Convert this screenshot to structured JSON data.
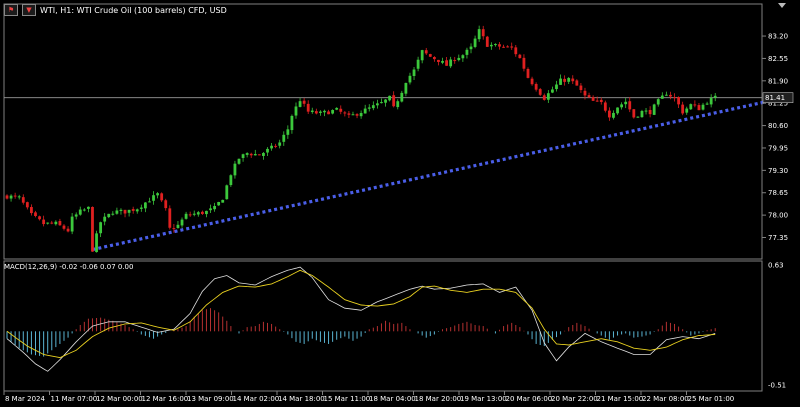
{
  "header": {
    "symbol_icon": "flag-icon",
    "indicator_icon": "candles-icon",
    "title": "WTI, H1:  WTI Crude Oil (100 barrels) CFD, USD"
  },
  "macd_label": "MACD(12,26,9) -0.02 -0.06 0.07 0.00",
  "colors": {
    "background": "#000000",
    "bull": "#3cc83c",
    "bear": "#e02020",
    "trendline": "#4a5ee8",
    "hist_pos": "#b43030",
    "hist_neg": "#5ab4d2",
    "signal": "#e8d020",
    "macd_line": "#e0e0e0",
    "grid": "#808080"
  },
  "chart_data": [
    {
      "type": "candlestick",
      "symbol": "WTI",
      "timeframe": "H1",
      "y_ticks": [
        "83.20",
        "82.55",
        "81.90",
        "81.25",
        "80.60",
        "79.95",
        "79.30",
        "78.65",
        "78.00",
        "77.35"
      ],
      "ylim": [
        76.9,
        83.55
      ],
      "current_price": "81.41",
      "x_ticks": [
        "8 Mar 2024",
        "11 Mar 07:00",
        "12 Mar 00:00",
        "12 Mar 16:00",
        "13 Mar 09:00",
        "14 Mar 02:00",
        "14 Mar 18:00",
        "15 Mar 11:00",
        "18 Mar 04:00",
        "18 Mar 20:00",
        "19 Mar 13:00",
        "20 Mar 06:00",
        "20 Mar 22:00",
        "21 Mar 15:00",
        "22 Mar 08:00",
        "25 Mar 01:00"
      ],
      "close_path": [
        [
          0,
          78.55
        ],
        [
          3,
          78.5
        ],
        [
          6,
          78.0
        ],
        [
          9,
          77.75
        ],
        [
          12,
          77.75
        ],
        [
          15,
          77.55
        ],
        [
          16,
          77.9
        ],
        [
          18,
          78.1
        ],
        [
          20,
          78.2
        ],
        [
          21,
          77.0
        ],
        [
          23,
          77.8
        ],
        [
          26,
          78.1
        ],
        [
          29,
          78.1
        ],
        [
          32,
          78.2
        ],
        [
          35,
          78.45
        ],
        [
          37,
          78.6
        ],
        [
          39,
          78.15
        ],
        [
          40,
          77.6
        ],
        [
          42,
          77.7
        ],
        [
          44,
          78.0
        ],
        [
          47,
          78.05
        ],
        [
          49,
          78.1
        ],
        [
          51,
          78.2
        ],
        [
          53,
          78.5
        ],
        [
          55,
          79.2
        ],
        [
          57,
          79.65
        ],
        [
          59,
          79.8
        ],
        [
          62,
          79.75
        ],
        [
          65,
          79.95
        ],
        [
          67,
          80.1
        ],
        [
          69,
          80.5
        ],
        [
          70,
          80.9
        ],
        [
          72,
          81.35
        ],
        [
          74,
          81.0
        ],
        [
          77,
          80.95
        ],
        [
          79,
          81.0
        ],
        [
          81,
          81.05
        ],
        [
          84,
          80.85
        ],
        [
          86,
          80.95
        ],
        [
          88,
          81.05
        ],
        [
          90,
          81.15
        ],
        [
          92,
          81.25
        ],
        [
          94,
          81.4
        ],
        [
          95,
          81.1
        ],
        [
          97,
          81.6
        ],
        [
          98,
          81.9
        ],
        [
          100,
          82.2
        ],
        [
          102,
          82.75
        ],
        [
          104,
          82.6
        ],
        [
          106,
          82.5
        ],
        [
          108,
          82.35
        ],
        [
          110,
          82.55
        ],
        [
          112,
          82.65
        ],
        [
          114,
          82.85
        ],
        [
          116,
          83.35
        ],
        [
          118,
          82.95
        ],
        [
          121,
          82.9
        ],
        [
          124,
          82.85
        ],
        [
          126,
          82.55
        ],
        [
          128,
          82.0
        ],
        [
          130,
          81.7
        ],
        [
          132,
          81.4
        ],
        [
          134,
          81.65
        ],
        [
          136,
          81.9
        ],
        [
          138,
          81.95
        ],
        [
          140,
          81.75
        ],
        [
          142,
          81.45
        ],
        [
          144,
          81.3
        ],
        [
          146,
          81.25
        ],
        [
          148,
          80.9
        ],
        [
          150,
          81.15
        ],
        [
          152,
          81.3
        ],
        [
          154,
          80.85
        ],
        [
          156,
          81.0
        ],
        [
          158,
          81.0
        ],
        [
          160,
          81.3
        ],
        [
          162,
          81.55
        ],
        [
          164,
          81.4
        ],
        [
          166,
          81.0
        ],
        [
          168,
          81.2
        ],
        [
          170,
          81.1
        ],
        [
          172,
          81.3
        ],
        [
          174,
          81.41
        ]
      ],
      "trendline": {
        "style": "dotted",
        "from": [
          21,
          77.0
        ],
        "to": [
          186,
          81.28
        ]
      }
    },
    {
      "type": "bar",
      "indicator": "MACD",
      "params": [
        12,
        26,
        9
      ],
      "readout": [
        -0.02,
        -0.06,
        0.07,
        0.0
      ],
      "y_ticks": [
        "0.63",
        "-0.51"
      ],
      "ylim": [
        -0.51,
        0.63
      ],
      "histogram_path": [
        [
          0,
          -0.07
        ],
        [
          3,
          -0.16
        ],
        [
          6,
          -0.22
        ],
        [
          9,
          -0.24
        ],
        [
          12,
          -0.15
        ],
        [
          15,
          -0.06
        ],
        [
          18,
          0.06
        ],
        [
          20,
          0.12
        ],
        [
          23,
          0.13
        ],
        [
          26,
          0.1
        ],
        [
          29,
          0.06
        ],
        [
          31,
          0.02
        ],
        [
          33,
          -0.03
        ],
        [
          36,
          -0.07
        ],
        [
          38,
          -0.03
        ],
        [
          40,
          0.0
        ],
        [
          42,
          0.02
        ],
        [
          44,
          0.05
        ],
        [
          46,
          0.14
        ],
        [
          48,
          0.2
        ],
        [
          50,
          0.22
        ],
        [
          52,
          0.18
        ],
        [
          54,
          0.1
        ],
        [
          56,
          0.0
        ],
        [
          57,
          -0.02
        ],
        [
          59,
          0.04
        ],
        [
          61,
          0.05
        ],
        [
          63,
          0.09
        ],
        [
          65,
          0.07
        ],
        [
          67,
          0.02
        ],
        [
          69,
          -0.03
        ],
        [
          71,
          -0.1
        ],
        [
          73,
          -0.12
        ],
        [
          75,
          -0.07
        ],
        [
          77,
          -0.1
        ],
        [
          79,
          -0.12
        ],
        [
          81,
          -0.08
        ],
        [
          83,
          -0.05
        ],
        [
          85,
          -0.09
        ],
        [
          87,
          -0.05
        ],
        [
          89,
          0.02
        ],
        [
          91,
          0.05
        ],
        [
          93,
          0.1
        ],
        [
          95,
          0.07
        ],
        [
          97,
          0.08
        ],
        [
          99,
          0.02
        ],
        [
          101,
          -0.02
        ],
        [
          103,
          -0.06
        ],
        [
          105,
          -0.03
        ],
        [
          107,
          0.02
        ],
        [
          109,
          0.04
        ],
        [
          111,
          0.07
        ],
        [
          113,
          0.09
        ],
        [
          115,
          0.06
        ],
        [
          117,
          0.05
        ],
        [
          119,
          0.0
        ],
        [
          120,
          -0.02
        ],
        [
          122,
          0.05
        ],
        [
          124,
          0.08
        ],
        [
          126,
          0.04
        ],
        [
          128,
          -0.03
        ],
        [
          130,
          -0.12
        ],
        [
          132,
          -0.14
        ],
        [
          134,
          -0.08
        ],
        [
          136,
          -0.03
        ],
        [
          138,
          0.04
        ],
        [
          140,
          0.08
        ],
        [
          142,
          0.05
        ],
        [
          144,
          0.0
        ],
        [
          146,
          -0.04
        ],
        [
          148,
          -0.08
        ],
        [
          150,
          -0.04
        ],
        [
          152,
          -0.02
        ],
        [
          154,
          -0.06
        ],
        [
          156,
          -0.05
        ],
        [
          158,
          -0.03
        ],
        [
          160,
          0.02
        ],
        [
          162,
          0.09
        ],
        [
          164,
          0.07
        ],
        [
          166,
          0.02
        ],
        [
          168,
          -0.04
        ],
        [
          170,
          -0.02
        ],
        [
          172,
          0.01
        ],
        [
          174,
          0.03
        ]
      ],
      "signal_path": [
        [
          0,
          0.0
        ],
        [
          5,
          -0.14
        ],
        [
          9,
          -0.22
        ],
        [
          13,
          -0.25
        ],
        [
          17,
          -0.18
        ],
        [
          21,
          -0.05
        ],
        [
          25,
          0.03
        ],
        [
          29,
          0.07
        ],
        [
          33,
          0.08
        ],
        [
          37,
          0.04
        ],
        [
          41,
          0.01
        ],
        [
          45,
          0.09
        ],
        [
          49,
          0.25
        ],
        [
          53,
          0.37
        ],
        [
          57,
          0.43
        ],
        [
          61,
          0.42
        ],
        [
          65,
          0.45
        ],
        [
          69,
          0.52
        ],
        [
          72,
          0.58
        ],
        [
          75,
          0.53
        ],
        [
          79,
          0.42
        ],
        [
          83,
          0.3
        ],
        [
          87,
          0.25
        ],
        [
          91,
          0.24
        ],
        [
          95,
          0.26
        ],
        [
          99,
          0.33
        ],
        [
          102,
          0.42
        ],
        [
          105,
          0.43
        ],
        [
          109,
          0.39
        ],
        [
          113,
          0.37
        ],
        [
          117,
          0.4
        ],
        [
          121,
          0.4
        ],
        [
          125,
          0.37
        ],
        [
          129,
          0.22
        ],
        [
          132,
          0.02
        ],
        [
          135,
          -0.12
        ],
        [
          138,
          -0.13
        ],
        [
          142,
          -0.1
        ],
        [
          146,
          -0.07
        ],
        [
          150,
          -0.1
        ],
        [
          154,
          -0.16
        ],
        [
          158,
          -0.18
        ],
        [
          162,
          -0.15
        ],
        [
          166,
          -0.08
        ],
        [
          170,
          -0.04
        ],
        [
          174,
          -0.03
        ]
      ],
      "macd_path": [
        [
          0,
          -0.07
        ],
        [
          4,
          -0.2
        ],
        [
          7,
          -0.31
        ],
        [
          10,
          -0.38
        ],
        [
          13,
          -0.27
        ],
        [
          17,
          -0.1
        ],
        [
          21,
          0.05
        ],
        [
          25,
          0.09
        ],
        [
          29,
          0.09
        ],
        [
          33,
          0.04
        ],
        [
          37,
          -0.01
        ],
        [
          41,
          0.02
        ],
        [
          45,
          0.17
        ],
        [
          48,
          0.38
        ],
        [
          51,
          0.5
        ],
        [
          54,
          0.53
        ],
        [
          57,
          0.46
        ],
        [
          61,
          0.44
        ],
        [
          65,
          0.52
        ],
        [
          69,
          0.58
        ],
        [
          72,
          0.61
        ],
        [
          75,
          0.51
        ],
        [
          79,
          0.3
        ],
        [
          83,
          0.22
        ],
        [
          87,
          0.2
        ],
        [
          91,
          0.28
        ],
        [
          95,
          0.34
        ],
        [
          99,
          0.4
        ],
        [
          102,
          0.43
        ],
        [
          105,
          0.4
        ],
        [
          109,
          0.41
        ],
        [
          113,
          0.44
        ],
        [
          117,
          0.45
        ],
        [
          121,
          0.37
        ],
        [
          125,
          0.42
        ],
        [
          129,
          0.2
        ],
        [
          132,
          -0.11
        ],
        [
          135,
          -0.28
        ],
        [
          138,
          -0.15
        ],
        [
          142,
          -0.02
        ],
        [
          146,
          -0.1
        ],
        [
          150,
          -0.16
        ],
        [
          154,
          -0.22
        ],
        [
          158,
          -0.22
        ],
        [
          162,
          -0.08
        ],
        [
          166,
          -0.05
        ],
        [
          170,
          -0.07
        ],
        [
          174,
          -0.02
        ]
      ]
    }
  ]
}
